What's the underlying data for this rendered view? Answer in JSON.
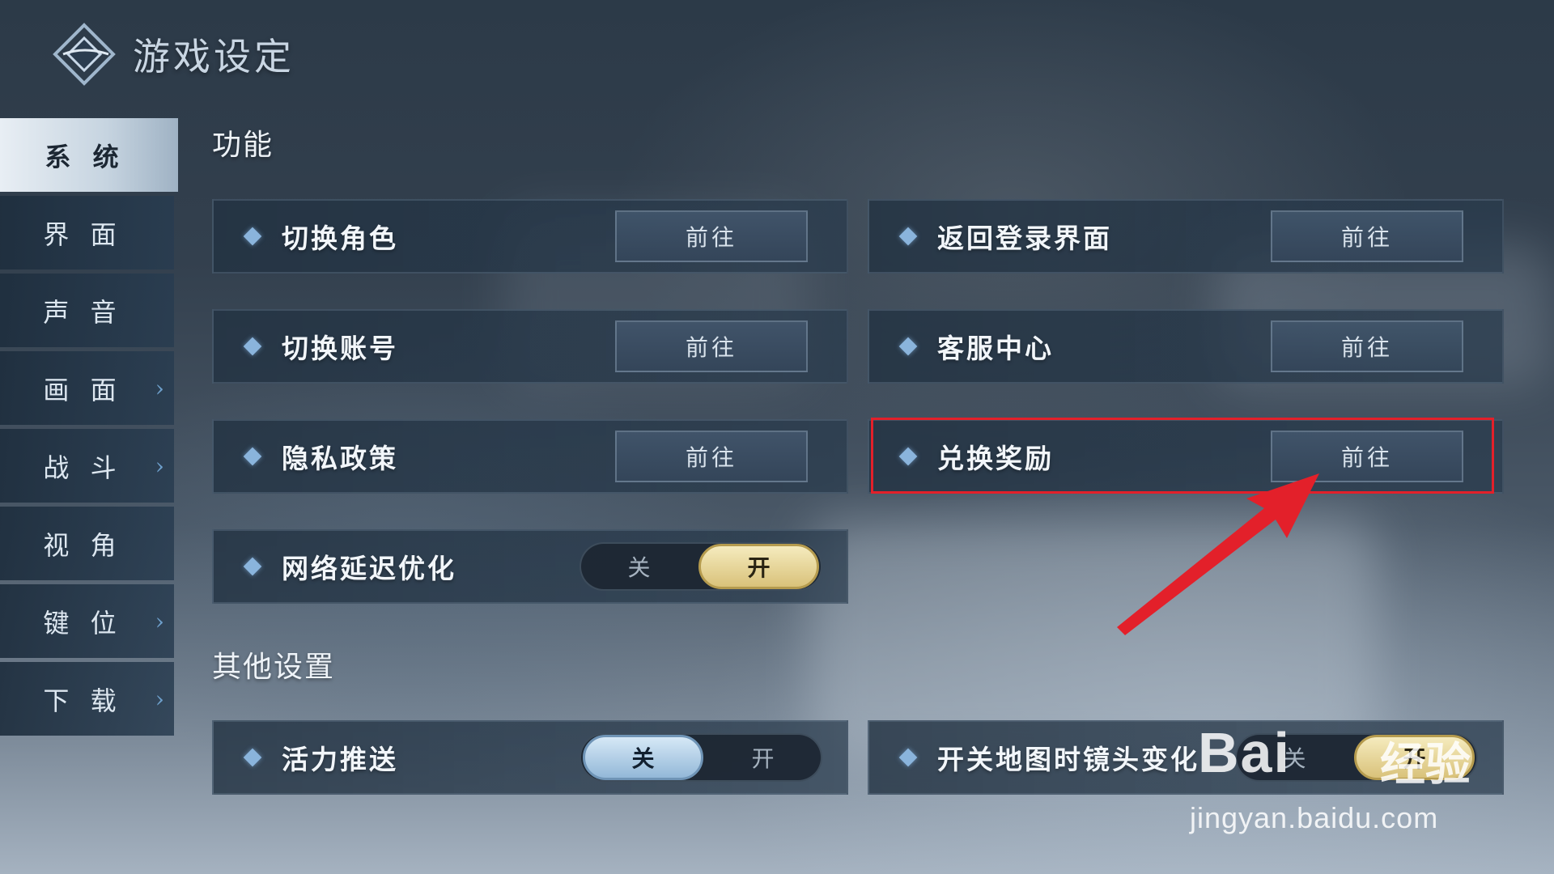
{
  "header": {
    "title": "游戏设定"
  },
  "sidebar": {
    "items": [
      {
        "label": "系 统",
        "active": true,
        "has_arrow": false
      },
      {
        "label": "界 面",
        "active": false,
        "has_arrow": false
      },
      {
        "label": "声 音",
        "active": false,
        "has_arrow": false
      },
      {
        "label": "画 面",
        "active": false,
        "has_arrow": true
      },
      {
        "label": "战 斗",
        "active": false,
        "has_arrow": true
      },
      {
        "label": "视 角",
        "active": false,
        "has_arrow": false
      },
      {
        "label": "键 位",
        "active": false,
        "has_arrow": true
      },
      {
        "label": "下 载",
        "active": false,
        "has_arrow": true
      }
    ]
  },
  "sections": {
    "function": {
      "title": "功能",
      "rows": [
        {
          "label": "切换角色",
          "button": "前往"
        },
        {
          "label": "返回登录界面",
          "button": "前往"
        },
        {
          "label": "切换账号",
          "button": "前往"
        },
        {
          "label": "客服中心",
          "button": "前往"
        },
        {
          "label": "隐私政策",
          "button": "前往"
        },
        {
          "label": "兑换奖励",
          "button": "前往"
        }
      ],
      "network": {
        "label": "网络延迟优化",
        "off": "关",
        "on": "开",
        "selected": "开"
      }
    },
    "other": {
      "title": "其他设置",
      "vitality": {
        "label": "活力推送",
        "off": "关",
        "on": "开",
        "selected": "关"
      },
      "map_camera": {
        "label": "开关地图时镜头变化",
        "off": "关",
        "on": "开",
        "selected": "开"
      }
    }
  },
  "watermark": {
    "main": "Bai",
    "cn": "经验",
    "sub": "jingyan.baidu.com"
  },
  "colors": {
    "highlight": "#e3202a",
    "accent_gold": "#d9c27a",
    "accent_blue": "#93b8d8"
  }
}
